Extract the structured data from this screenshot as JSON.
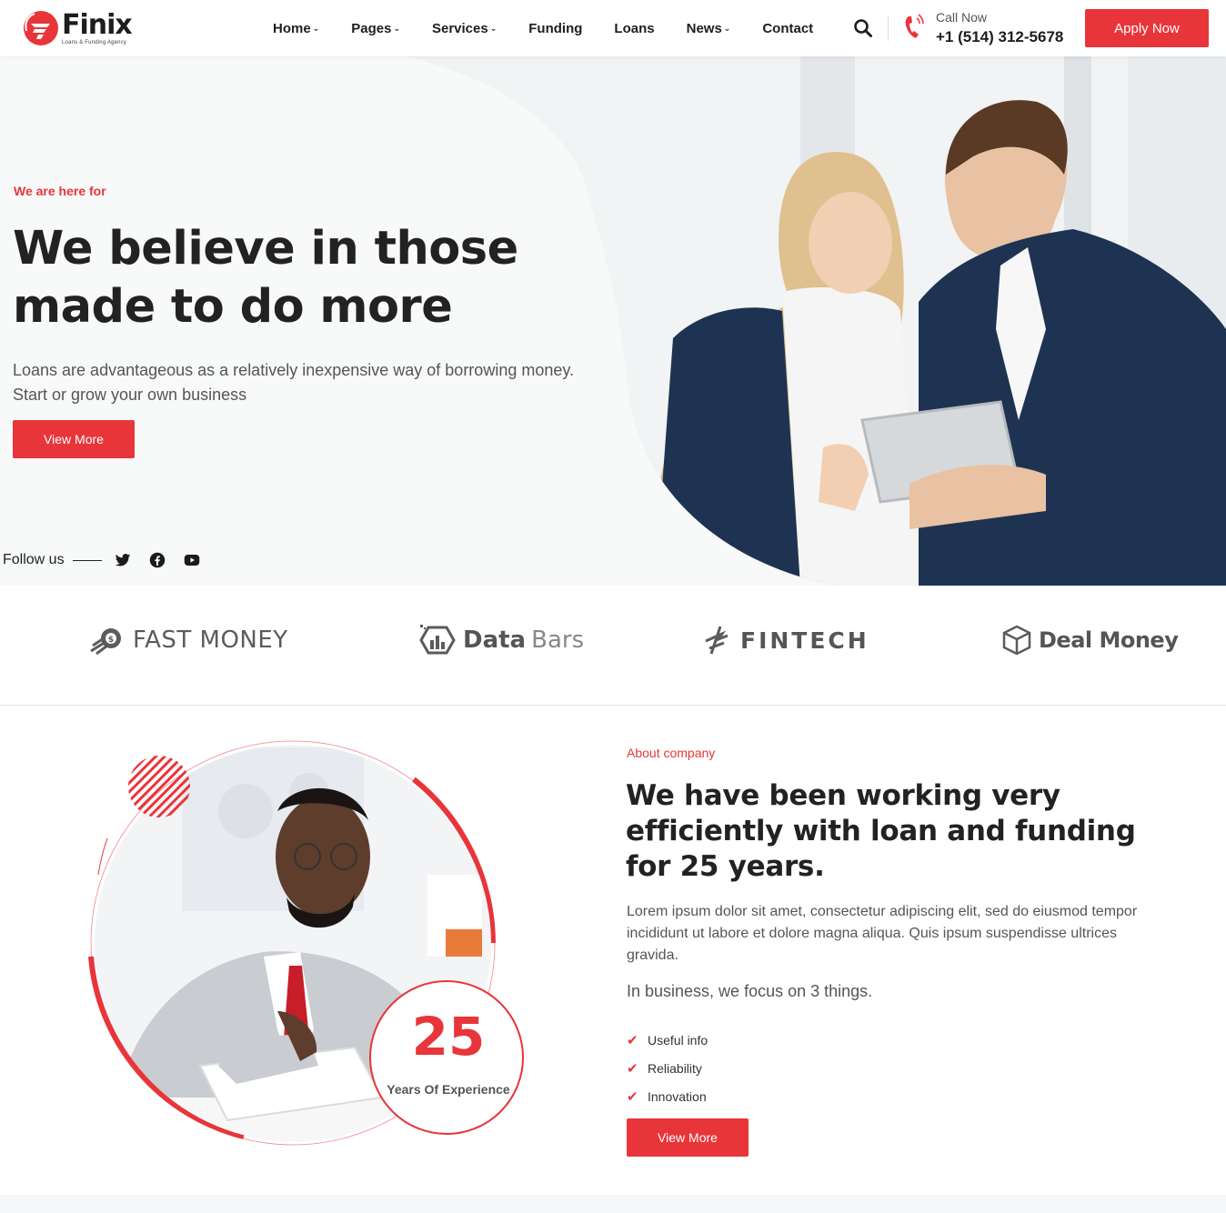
{
  "colors": {
    "accent": "#e8353a",
    "dark": "#222222",
    "muted": "#555555",
    "hero_bg": "#f8f9f9"
  },
  "logo": {
    "name": "Finix",
    "tagline": "Loans & Funding Agency"
  },
  "nav": {
    "items": [
      {
        "label": "Home",
        "dropdown": true
      },
      {
        "label": "Pages",
        "dropdown": true
      },
      {
        "label": "Services",
        "dropdown": true
      },
      {
        "label": "Funding",
        "dropdown": false
      },
      {
        "label": "Loans",
        "dropdown": false
      },
      {
        "label": "News",
        "dropdown": true
      },
      {
        "label": "Contact",
        "dropdown": false
      }
    ],
    "search_icon": "search-icon"
  },
  "call": {
    "label": "Call Now",
    "number": "+1 (514) 312-5678",
    "icon": "phone-icon"
  },
  "apply_label": "Apply Now",
  "hero": {
    "eyebrow": "We are here for",
    "title": "We believe in those made to do more",
    "description": "Loans are advantageous as a relatively inexpensive way of borrowing money. Start or grow your own business",
    "button": "View More",
    "follow_label": "Follow us",
    "social": [
      "twitter-icon",
      "facebook-icon",
      "youtube-icon"
    ]
  },
  "brands": {
    "fast_money": "FAST MONEY",
    "data_bars_1": "Data",
    "data_bars_2": "Bars",
    "fintech": "FINTECH",
    "deal_money": "Deal Money"
  },
  "about": {
    "experience_number": "25",
    "experience_label": "Years Of Experience",
    "eyebrow": "About company",
    "title": "We have been working very efficiently with loan and funding for 25 years.",
    "description": "Lorem ipsum dolor sit amet, consectetur adipiscing elit, sed do eiusmod tempor incididunt ut labore et dolore magna aliqua. Quis ipsum suspendisse ultrices gravida.",
    "focus": "In business, we focus on 3 things.",
    "checks": [
      "Useful info",
      "Reliability",
      "Innovation"
    ],
    "button": "View More"
  }
}
